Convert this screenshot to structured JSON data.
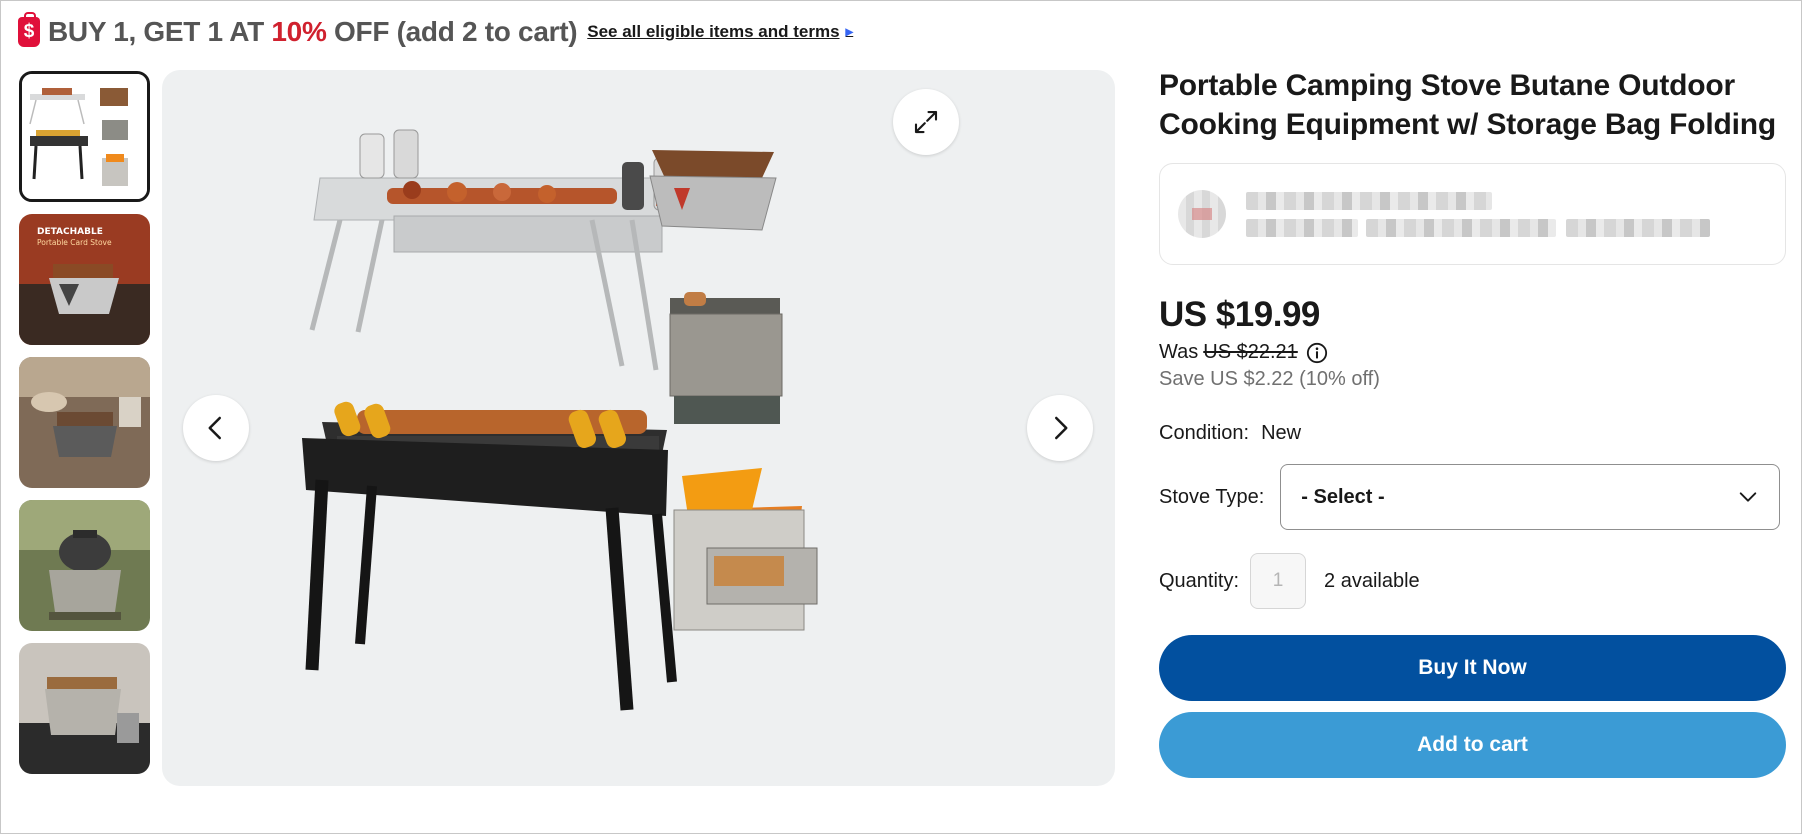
{
  "promo": {
    "icon": "shopping-bag-dollar-icon",
    "text_lead": "BUY 1, GET 1 AT ",
    "text_percent": "10%",
    "text_tail": " OFF (add 2 to cart)",
    "link_label": "See all eligible items and terms",
    "link_icon": "triangle-right-icon",
    "accent_color": "#d0212e"
  },
  "gallery": {
    "thumbnail_count": 5,
    "selected_index": 0,
    "expand_icon": "expand-arrows-icon",
    "prev_icon": "chevron-left-icon",
    "next_icon": "chevron-right-icon",
    "thumbnail_texts": {
      "thumb2_line1": "DETACHABLE",
      "thumb2_line2": "Portable Card Stove"
    }
  },
  "product": {
    "title": "Portable Camping Stove Butane Outdoor Cooking Equipment w/ Storage Bag Folding",
    "price": "US $19.99",
    "was_label": "Was",
    "was_price": "US $22.21",
    "info_icon": "info-circle-icon",
    "save_text": "Save US $2.22 (10% off)",
    "condition_label": "Condition:",
    "condition_value": "New",
    "stove_type_label": "Stove Type:",
    "stove_type_value": "- Select -",
    "dropdown_icon": "chevron-down-icon",
    "quantity_label": "Quantity:",
    "quantity_value": "1",
    "available_text": "2 available",
    "buy_now_label": "Buy It Now",
    "add_to_cart_label": "Add to cart"
  },
  "colors": {
    "buy_now_bg": "#02509f",
    "add_to_cart_bg": "#3b9bd5",
    "image_bg": "#eef0f1"
  }
}
